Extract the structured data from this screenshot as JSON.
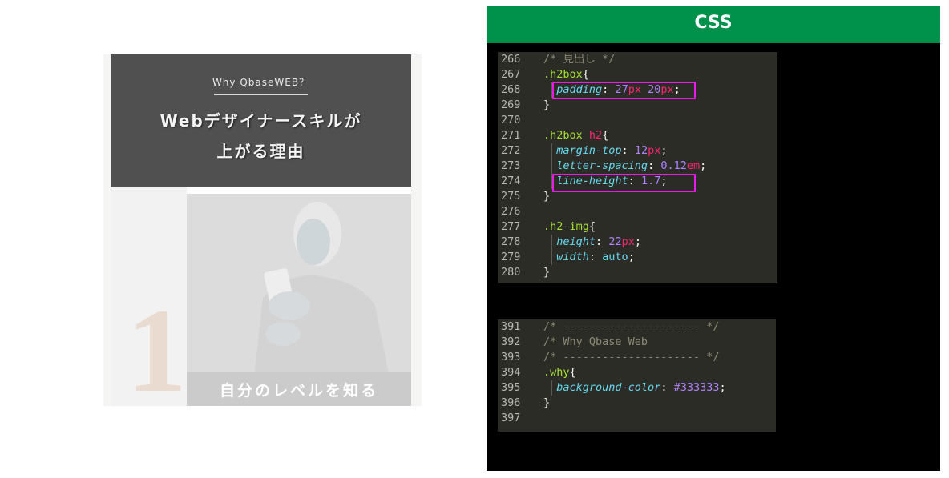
{
  "preview": {
    "why_label": "Why QbaseWEB？",
    "title_line1": "Webデザイナースキルが",
    "title_line2": "上がる理由",
    "number": "1",
    "caption": "自分のレベルを知る",
    "colors": {
      "hero_bg": "#505050",
      "number_color": "#eadbd1"
    }
  },
  "panel": {
    "title": "CSS",
    "header_color": "#00924a"
  },
  "code_block_1": [
    {
      "ln": "266",
      "tokens": [
        [
          "c-comment",
          "/* 見出し */"
        ]
      ]
    },
    {
      "ln": "267",
      "tokens": [
        [
          "c-sel",
          ".h2box"
        ],
        [
          "c-brace",
          "{"
        ]
      ]
    },
    {
      "ln": "268",
      "tokens": [
        [
          "c-punct",
          "  "
        ],
        [
          "c-prop",
          "padding"
        ],
        [
          "c-punct",
          ": "
        ],
        [
          "c-num",
          "27"
        ],
        [
          "c-unit",
          "px"
        ],
        [
          "c-punct",
          " "
        ],
        [
          "c-num",
          "20"
        ],
        [
          "c-unit",
          "px"
        ],
        [
          "c-punct",
          ";"
        ]
      ]
    },
    {
      "ln": "269",
      "tokens": [
        [
          "c-brace",
          "}"
        ]
      ]
    },
    {
      "ln": "270",
      "tokens": []
    },
    {
      "ln": "271",
      "tokens": [
        [
          "c-sel",
          ".h2box "
        ],
        [
          "c-tag",
          "h2"
        ],
        [
          "c-brace",
          "{"
        ]
      ]
    },
    {
      "ln": "272",
      "tokens": [
        [
          "c-punct",
          "  "
        ],
        [
          "c-prop",
          "margin-top"
        ],
        [
          "c-punct",
          ": "
        ],
        [
          "c-num",
          "12"
        ],
        [
          "c-unit",
          "px"
        ],
        [
          "c-punct",
          ";"
        ]
      ]
    },
    {
      "ln": "273",
      "tokens": [
        [
          "c-punct",
          "  "
        ],
        [
          "c-prop",
          "letter-spacing"
        ],
        [
          "c-punct",
          ": "
        ],
        [
          "c-num",
          "0.12"
        ],
        [
          "c-unit",
          "em"
        ],
        [
          "c-punct",
          ";"
        ]
      ]
    },
    {
      "ln": "274",
      "tokens": [
        [
          "c-punct",
          "  "
        ],
        [
          "c-prop",
          "line-height"
        ],
        [
          "c-punct",
          ": "
        ],
        [
          "c-num",
          "1.7"
        ],
        [
          "c-punct",
          ";"
        ]
      ]
    },
    {
      "ln": "275",
      "tokens": [
        [
          "c-brace",
          "}"
        ]
      ]
    },
    {
      "ln": "276",
      "tokens": []
    },
    {
      "ln": "277",
      "tokens": [
        [
          "c-sel",
          ".h2-img"
        ],
        [
          "c-brace",
          "{"
        ]
      ]
    },
    {
      "ln": "278",
      "tokens": [
        [
          "c-punct",
          "  "
        ],
        [
          "c-prop",
          "height"
        ],
        [
          "c-punct",
          ": "
        ],
        [
          "c-num",
          "22"
        ],
        [
          "c-unit",
          "px"
        ],
        [
          "c-punct",
          ";"
        ]
      ]
    },
    {
      "ln": "279",
      "tokens": [
        [
          "c-punct",
          "  "
        ],
        [
          "c-prop",
          "width"
        ],
        [
          "c-punct",
          ": "
        ],
        [
          "c-kw",
          "auto"
        ],
        [
          "c-punct",
          ";"
        ]
      ]
    },
    {
      "ln": "280",
      "tokens": [
        [
          "c-brace",
          "}"
        ]
      ]
    }
  ],
  "code_block_2": [
    {
      "ln": "391",
      "tokens": [
        [
          "c-comment",
          "/* --------------------- */"
        ]
      ]
    },
    {
      "ln": "392",
      "tokens": [
        [
          "c-comment",
          "/* Why Qbase Web"
        ]
      ]
    },
    {
      "ln": "393",
      "tokens": [
        [
          "c-comment",
          "/* --------------------- */"
        ]
      ]
    },
    {
      "ln": "394",
      "tokens": [
        [
          "c-sel",
          ".why"
        ],
        [
          "c-brace",
          "{"
        ]
      ]
    },
    {
      "ln": "395",
      "tokens": [
        [
          "c-punct",
          "  "
        ],
        [
          "c-prop",
          "background-color"
        ],
        [
          "c-punct",
          ": "
        ],
        [
          "c-num",
          "#333333"
        ],
        [
          "c-punct",
          ";"
        ]
      ]
    },
    {
      "ln": "396",
      "tokens": [
        [
          "c-brace",
          "}"
        ]
      ]
    },
    {
      "ln": "397",
      "tokens": []
    }
  ],
  "highlight_color": "#e61de6"
}
